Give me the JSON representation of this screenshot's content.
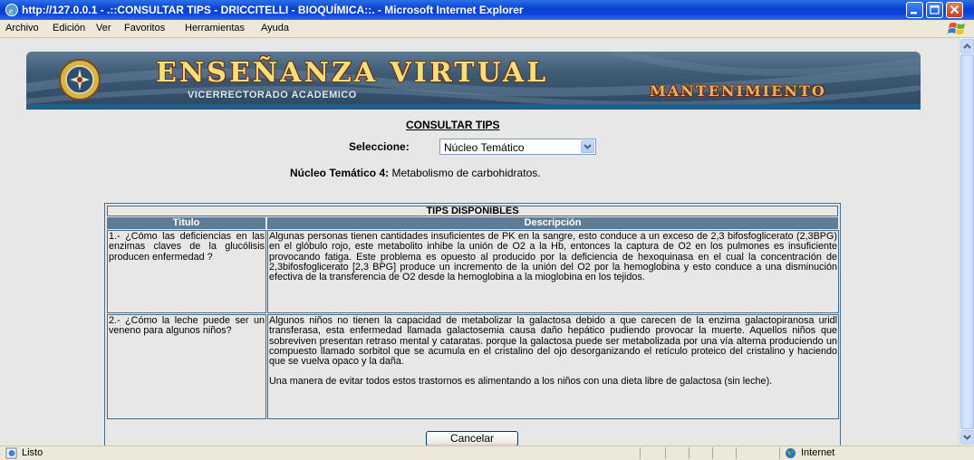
{
  "window": {
    "title": "http://127.0.0.1 - .::CONSULTAR TIPS - DRICCITELLI - BIOQUÍMICA::. - Microsoft Internet Explorer"
  },
  "menu": [
    "Archivo",
    "Edición",
    "Ver",
    "Favoritos",
    "Herramientas",
    "Ayuda"
  ],
  "banner": {
    "title": "ENSEÑANZA VIRTUAL",
    "subtitle": "VICERRECTORADO ACADEMICO",
    "section": "MANTENIMIENTO"
  },
  "page": {
    "heading": "CONSULTAR TIPS",
    "select_label": "Seleccione:",
    "select_value": "Núcleo Temático",
    "nucleo_label": "Núcleo Temático 4:",
    "nucleo_value": "Metabolismo de carbohidratos."
  },
  "table": {
    "header": "TIPS DISPONIBLES",
    "columns": [
      "Titulo",
      "Descripción"
    ],
    "rows": [
      {
        "title": "1.- ¿Cómo las deficiencias en las enzimas claves de la glucólisis producen enfermedad ?",
        "description": [
          "Algunas personas tienen cantidades insuficientes de PK en la sangre, esto conduce a un exceso de 2,3 bifosfoglicerato (2,3BPG) en el glóbulo rojo, este metabolito inhibe la unión de O2 a la Hb, entonces la captura de O2 en los pulmones es insuficiente provocando fatiga. Este problema es opuesto al producido por la deficiencia de hexoquinasa en el cual la concentración de 2,3bifosfoglicerato [2,3 BPG] produce un incremento de la unión del O2 por la hemoglobina y esto conduce a una disminución efectiva de la transferencia de O2 desde la hemoglobina a la mioglobina en los tejidos."
        ]
      },
      {
        "title": "2.- ¿Cómo la leche puede ser un veneno para algunos niños?",
        "description": [
          "Algunos niños no tienen la capacidad de metabolizar la galactosa debido a que carecen de la enzima galactopiranosa uridl transferasa, esta enfermedad llamada galactosemia causa daño hepático pudiendo provocar la muerte. Aquellos niños que sobreviven presentan retraso mental y cataratas. porque la galactosa puede ser metabolizada por una vía alterna produciendo un compuesto llamado sorbitol que se acumula en el cristalino del ojo desorganizando el retículo proteico del cristalino y haciendo que se vuelva opaco y la daña.",
          "Una manera de evitar todos estos trastornos es alimentando a los niños con una dieta libre de galactosa (sin leche)."
        ]
      }
    ]
  },
  "buttons": {
    "cancel": "Cancelar"
  },
  "status": {
    "text": "Listo",
    "zone": "Internet"
  },
  "colors": {
    "titlebar": "#0A3FD0",
    "banner_rule": "#1F5E8A",
    "column_header": "#5E7C95",
    "banner_title": "#F3DF7B"
  },
  "icons": [
    "ie-icon",
    "minimize-icon",
    "maximize-icon",
    "close-icon",
    "windows-logo-icon",
    "university-emblem-icon",
    "dropdown-arrow-icon",
    "page-done-icon",
    "internet-globe-icon"
  ]
}
